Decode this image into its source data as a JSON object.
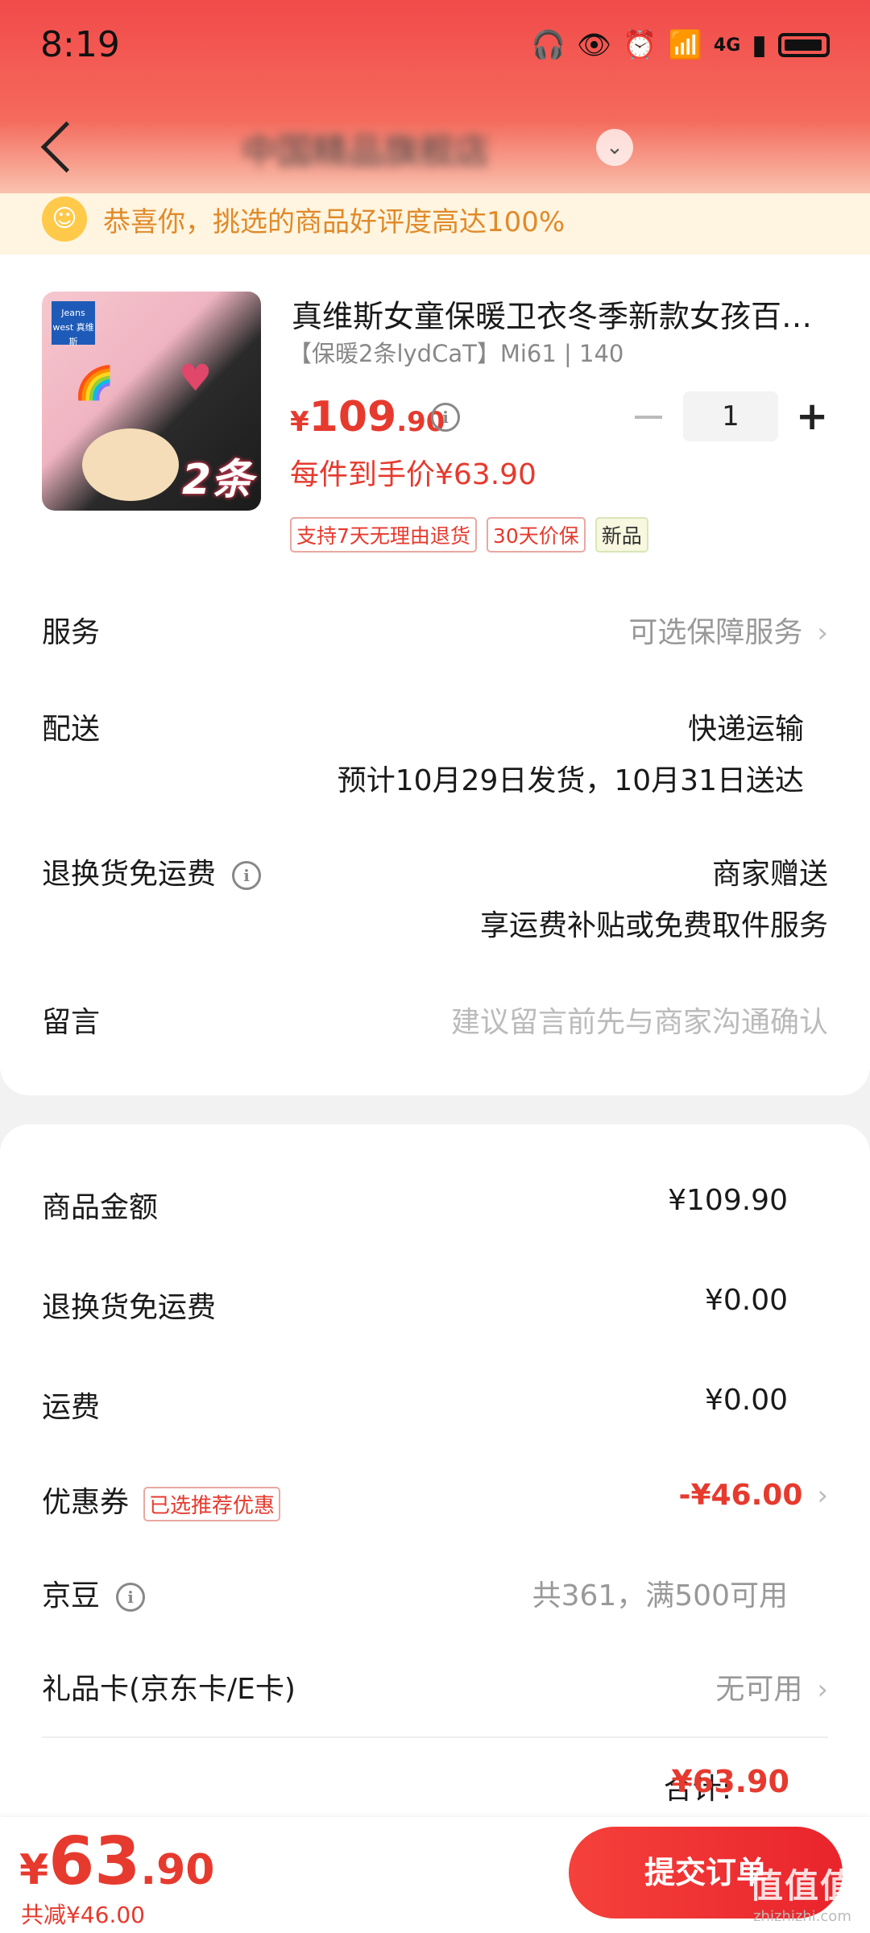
{
  "status_bar": {
    "time": "8:19",
    "network": "4G"
  },
  "nav": {
    "shop_name": "中国精品旗舰店",
    "shop_badge_icon": "chevron-down-icon"
  },
  "banner": {
    "text": "恭喜你，挑选的商品好评度高达100%"
  },
  "product": {
    "title": "真维斯女童保暖卫衣冬季新款女孩百…",
    "spec": "【保暖2条lydCaT】Mi61 | 140",
    "image_brand": "Jeans west 真维斯",
    "image_count": "2条",
    "price_currency": "¥",
    "price_int": "109",
    "price_dec": ".90",
    "quantity": "1",
    "each_price": "每件到手价¥63.90",
    "tags": [
      "支持7天无理由退货",
      "30天价保",
      "新品"
    ]
  },
  "details": {
    "service": {
      "label": "服务",
      "value": "可选保障服务"
    },
    "delivery": {
      "label": "配送",
      "method": "快递运输",
      "eta": "预计10月29日发货，10月31日送达"
    },
    "return_shipping": {
      "label": "退换货免运费",
      "value1": "商家赠送",
      "value2": "享运费补贴或免费取件服务"
    },
    "message": {
      "label": "留言",
      "placeholder": "建议留言前先与商家沟通确认"
    }
  },
  "summary": {
    "goods": {
      "label": "商品金额",
      "value": "¥109.90"
    },
    "return_fee": {
      "label": "退换货免运费",
      "value": "¥0.00"
    },
    "shipping": {
      "label": "运费",
      "value": "¥0.00"
    },
    "coupon": {
      "label": "优惠券",
      "badge": "已选推荐优惠",
      "value": "-¥46.00"
    },
    "jingdou": {
      "label": "京豆",
      "value": "共361，满500可用"
    },
    "giftcard": {
      "label": "礼品卡(京东卡/E卡)",
      "value": "无可用"
    },
    "total_label": "合计:",
    "total_value": "¥63.90"
  },
  "bottom": {
    "price_currency": "¥",
    "price_int": "63",
    "price_dec": ".90",
    "saved": "共减¥46.00",
    "submit_label": "提交订单"
  },
  "watermark": {
    "main": "值值值",
    "sub": "zhizhizhi.com"
  },
  "colors": {
    "accent": "#e63a2e",
    "header_top": "#f24a4a"
  }
}
